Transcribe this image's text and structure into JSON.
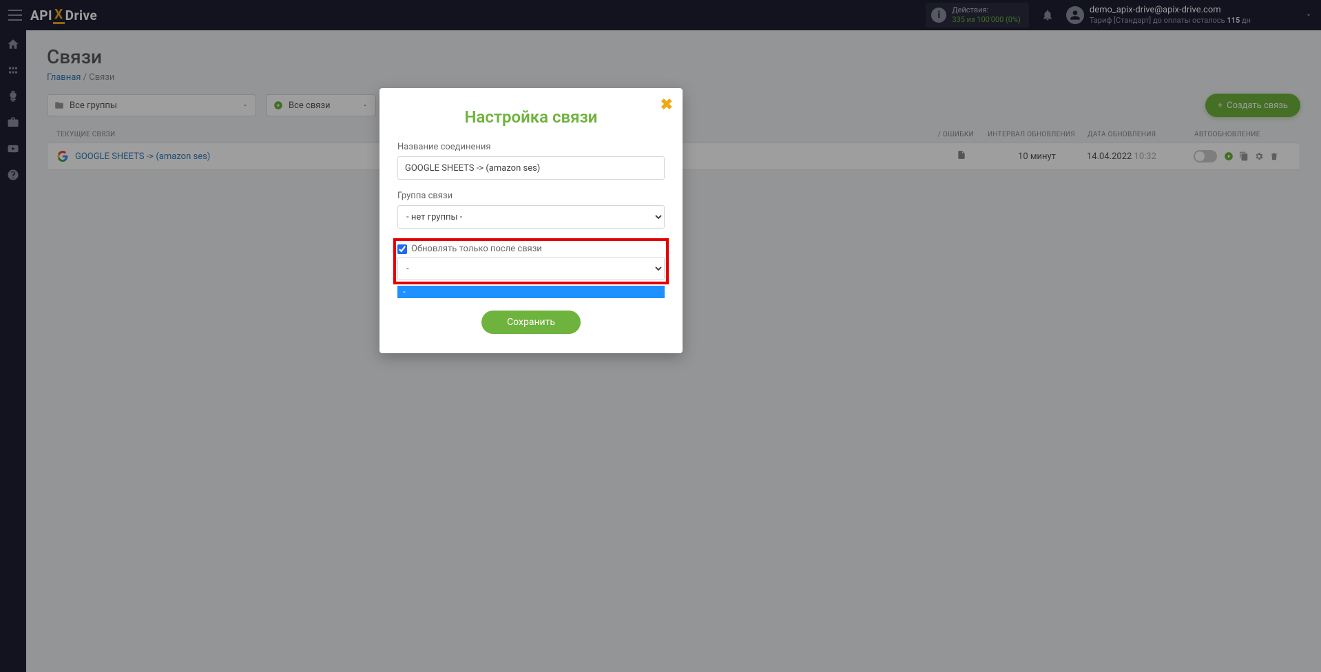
{
  "header": {
    "logo": {
      "api": "API",
      "x": "X",
      "drive": "Drive"
    },
    "actions": {
      "label": "Действия:",
      "stat": "335 из 100'000 (0%)"
    },
    "user": {
      "email": "demo_apix-drive@apix-drive.com",
      "plan_prefix": "Тариф [Стандарт] до оплаты осталось ",
      "plan_days": "115",
      "plan_suffix": " дн"
    }
  },
  "page": {
    "title": "Связи",
    "breadcrumb_home": "Главная",
    "breadcrumb_current": "Связи"
  },
  "filters": {
    "groups": "Все группы",
    "connections": "Все связи",
    "create_btn": "Создать связь"
  },
  "columns": {
    "name": "ТЕКУЩИЕ СВЯЗИ",
    "errors": "/ ОШИБКИ",
    "interval": "ИНТЕРВАЛ ОБНОВЛЕНИЯ",
    "date": "ДАТА ОБНОВЛЕНИЯ",
    "auto": "АВТООБНОВЛЕНИЕ"
  },
  "row": {
    "name": "GOOGLE SHEETS -> (amazon ses)",
    "interval": "10 минут",
    "date": "14.04.2022",
    "time": "10:32"
  },
  "modal": {
    "title": "Настройка связи",
    "label_name": "Название соединения",
    "value_name": "GOOGLE SHEETS -> (amazon ses)",
    "label_group": "Группа связи",
    "value_group": "- нет группы -",
    "checkbox_label": "Обновлять только после связи",
    "dependent_value": "-",
    "dropdown_open_value": "-",
    "save": "Сохранить"
  }
}
